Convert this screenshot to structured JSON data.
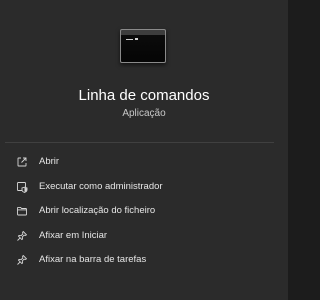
{
  "app": {
    "name": "Linha de comandos",
    "type": "Aplicação",
    "icon": "command-prompt-icon"
  },
  "actions": [
    {
      "label": "Abrir",
      "icon": "open-external-icon"
    },
    {
      "label": "Executar como administrador",
      "icon": "run-as-admin-icon"
    },
    {
      "label": "Abrir localização do ficheiro",
      "icon": "folder-icon"
    },
    {
      "label": "Afixar em Iniciar",
      "icon": "pin-icon"
    },
    {
      "label": "Afixar na barra de tarefas",
      "icon": "pin-icon"
    }
  ],
  "colors": {
    "background": "#2b2b2b",
    "text": "#ffffff",
    "secondary_text": "#c8c8c8",
    "divider": "#404040"
  }
}
